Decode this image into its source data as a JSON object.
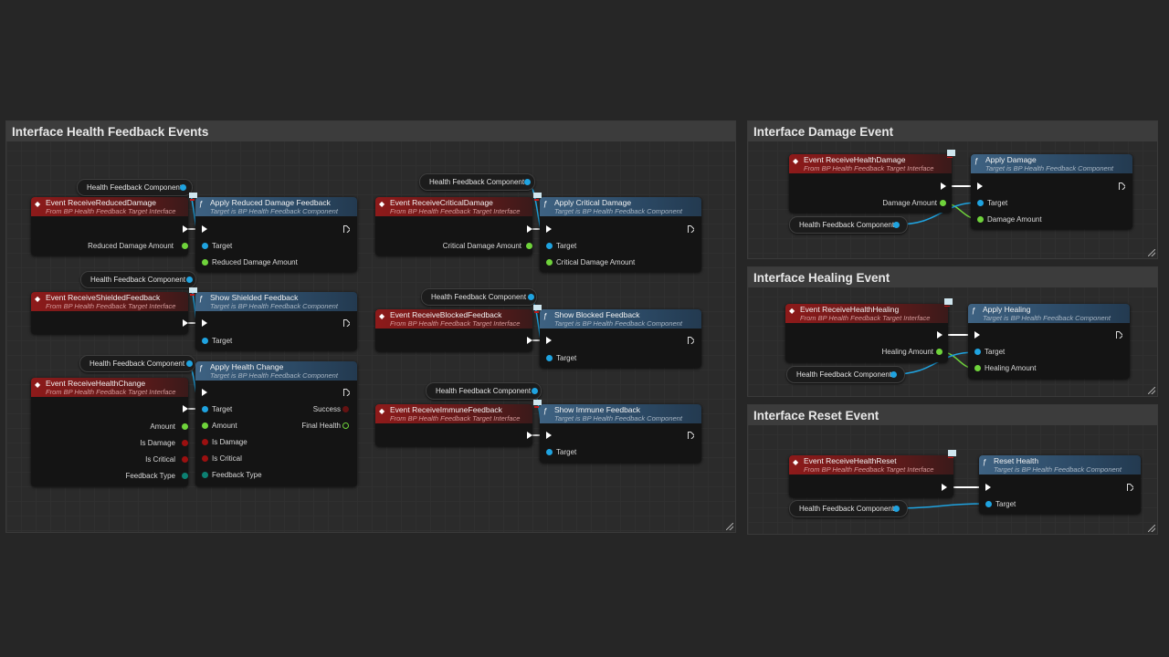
{
  "comments": {
    "health_feedback": "Interface Health Feedback Events",
    "damage": "Interface Damage Event",
    "healing": "Interface Healing Event",
    "reset": "Interface Reset Event"
  },
  "common": {
    "event_subtitle": "From BP Health Feedback Target Interface",
    "func_subtitle": "Target is BP Health Feedback Component",
    "var_component": "Health Feedback Component",
    "pin_target": "Target"
  },
  "nodes": {
    "reduced": {
      "event": "Event ReceiveReducedDamage",
      "param": "Reduced Damage Amount",
      "func": "Apply Reduced Damage Feedback",
      "func_param": "Reduced Damage Amount"
    },
    "critical": {
      "event": "Event ReceiveCriticalDamage",
      "param": "Critical Damage Amount",
      "func": "Apply Critical Damage",
      "func_param": "Critical Damage Amount"
    },
    "shielded": {
      "event": "Event ReceiveShieldedFeedback",
      "func": "Show Shielded Feedback"
    },
    "blocked": {
      "event": "Event ReceiveBlockedFeedback",
      "func": "Show Blocked Feedback"
    },
    "health_change": {
      "event": "Event ReceiveHealthChange",
      "params": [
        "Amount",
        "Is Damage",
        "Is Critical",
        "Feedback Type"
      ],
      "func": "Apply Health Change",
      "func_params": [
        "Amount",
        "Is Damage",
        "Is Critical",
        "Feedback Type"
      ],
      "outputs": [
        "Success",
        "Final Health"
      ]
    },
    "immune": {
      "event": "Event ReceiveImmuneFeedback",
      "func": "Show Immune Feedback"
    },
    "damage": {
      "event": "Event ReceiveHealthDamage",
      "param": "Damage Amount",
      "func": "Apply Damage",
      "func_param": "Damage Amount"
    },
    "healing": {
      "event": "Event ReceiveHealthHealing",
      "param": "Healing Amount",
      "func": "Apply Healing",
      "func_param": "Healing Amount"
    },
    "reset": {
      "event": "Event ReceiveHealthReset",
      "func": "Reset Health"
    }
  },
  "colors": {
    "event_header": "#8e1a1a",
    "function_header": "#3e6282",
    "object_pin": "#1fa3e0",
    "float_pin": "#6fd33b",
    "bool_pin": "#9b1010",
    "enum_pin": "#0c8072"
  }
}
